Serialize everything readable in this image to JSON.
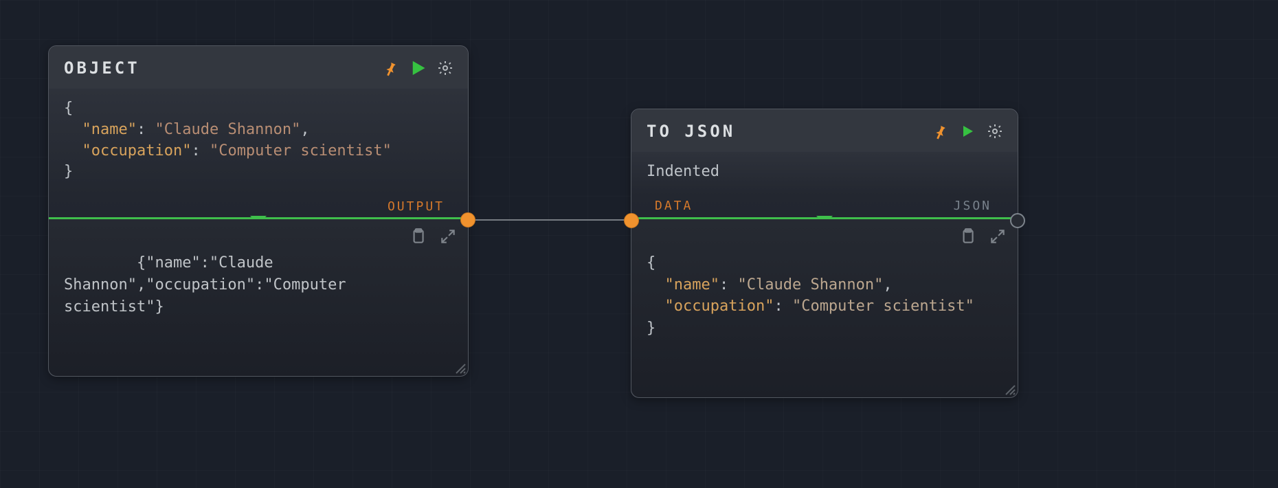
{
  "nodes": {
    "object": {
      "title": "OBJECT",
      "body_lines": [
        "{",
        "  \"name\": \"Claude Shannon\",",
        "  \"occupation\": \"Computer scientist\"",
        "}"
      ],
      "output_port_label": "OUTPUT",
      "output_text": "{\"name\":\"Claude Shannon\",\"occupation\":\"Computer scientist\"}"
    },
    "tojson": {
      "title": "TO JSON",
      "body_text": "Indented",
      "input_port_label": "DATA",
      "output_port_label": "JSON",
      "output_lines": [
        "{",
        "  \"name\": \"Claude Shannon\",",
        "  \"occupation\": \"Computer scientist\"",
        "}"
      ]
    }
  },
  "icons": {
    "pin": "pin-icon",
    "play": "play-icon",
    "gear": "gear-icon",
    "clipboard": "clipboard-icon",
    "expand": "expand-icon"
  },
  "colors": {
    "accent_orange": "#f0922e",
    "accent_green": "#3fbf4b"
  }
}
